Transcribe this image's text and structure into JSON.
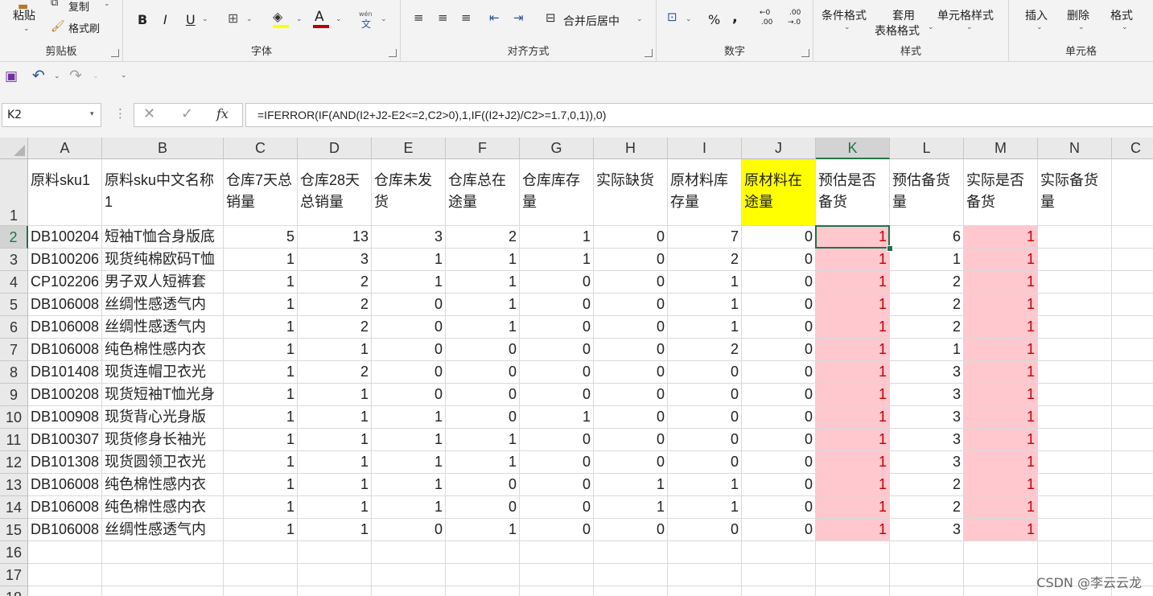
{
  "ribbon": {
    "clipboard": {
      "paste": "粘贴",
      "copy": "复制",
      "format_painter": "格式刷",
      "label": "剪贴板"
    },
    "font": {
      "label": "字体",
      "bold": "B",
      "italic": "I",
      "underline": "U",
      "font_color": "A",
      "phonetic_top": "wén",
      "phonetic_bottom": "文"
    },
    "alignment": {
      "merge_center": "合并后居中",
      "label": "对齐方式"
    },
    "number": {
      "percent": "%",
      "comma": ",",
      "inc_decimal_top": "←0",
      "inc_decimal_bottom": ".00",
      "dec_decimal_top": ".00",
      "dec_decimal_bottom": "→.0",
      "label": "数字"
    },
    "styles": {
      "conditional": "条件格式",
      "table_top": "套用",
      "table_bottom": "表格格式",
      "cell_styles": "单元格样式",
      "label": "样式"
    },
    "cells": {
      "insert": "插入",
      "delete": "删除",
      "format": "格式",
      "label": "单元格"
    }
  },
  "name_box": "K2",
  "formula": "=IFERROR(IF(AND(I2+J2-E2<=2,C2>0),1,IF((I2+J2)/C2>=1.7,0,1)),0)",
  "fx": "fx",
  "columns": [
    "A",
    "B",
    "C",
    "D",
    "E",
    "F",
    "G",
    "H",
    "I",
    "J",
    "K",
    "L",
    "M",
    "N",
    "C"
  ],
  "rows": [
    "1",
    "2",
    "3",
    "4",
    "5",
    "6",
    "7",
    "8",
    "9",
    "10",
    "11",
    "12",
    "13",
    "14",
    "15",
    "16",
    "17",
    "18"
  ],
  "headers": [
    "原料sku1",
    "原料sku中文名称1",
    "仓库7天总销量",
    "仓库28天总销量",
    "仓库未发货",
    "仓库总在途量",
    "仓库库存量",
    "实际缺货",
    "原材料库存量",
    "原材料在途量",
    "预估是否备货",
    "预估备货量",
    "实际是否备货",
    "实际备货量"
  ],
  "table": [
    [
      "DB100204",
      "短袖T恤合身版底",
      "5",
      "13",
      "3",
      "2",
      "1",
      "0",
      "7",
      "0",
      "1",
      "6",
      "1",
      ""
    ],
    [
      "DB100206",
      "现货纯棉欧码T恤",
      "1",
      "3",
      "1",
      "1",
      "1",
      "0",
      "2",
      "0",
      "1",
      "1",
      "1",
      ""
    ],
    [
      "CP102206",
      "男子双人短裤套",
      "1",
      "2",
      "1",
      "1",
      "0",
      "0",
      "1",
      "0",
      "1",
      "2",
      "1",
      ""
    ],
    [
      "DB106008",
      "丝绸性感透气内",
      "1",
      "2",
      "0",
      "1",
      "0",
      "0",
      "1",
      "0",
      "1",
      "2",
      "1",
      ""
    ],
    [
      "DB106008",
      "丝绸性感透气内",
      "1",
      "2",
      "0",
      "1",
      "0",
      "0",
      "1",
      "0",
      "1",
      "2",
      "1",
      ""
    ],
    [
      "DB106008",
      "纯色棉性感内衣",
      "1",
      "1",
      "0",
      "0",
      "0",
      "0",
      "2",
      "0",
      "1",
      "1",
      "1",
      ""
    ],
    [
      "DB101408",
      "现货连帽卫衣光",
      "1",
      "2",
      "0",
      "0",
      "0",
      "0",
      "0",
      "0",
      "1",
      "3",
      "1",
      ""
    ],
    [
      "DB100208",
      "现货短袖T恤光身",
      "1",
      "1",
      "0",
      "0",
      "0",
      "0",
      "0",
      "0",
      "1",
      "3",
      "1",
      ""
    ],
    [
      "DB100908",
      "现货背心光身版",
      "1",
      "1",
      "1",
      "0",
      "1",
      "0",
      "0",
      "0",
      "1",
      "3",
      "1",
      ""
    ],
    [
      "DB100307",
      "现货修身长袖光",
      "1",
      "1",
      "1",
      "1",
      "0",
      "0",
      "0",
      "0",
      "1",
      "3",
      "1",
      ""
    ],
    [
      "DB101308",
      "现货圆领卫衣光",
      "1",
      "1",
      "1",
      "1",
      "0",
      "0",
      "0",
      "0",
      "1",
      "3",
      "1",
      ""
    ],
    [
      "DB106008",
      "纯色棉性感内衣",
      "1",
      "1",
      "1",
      "0",
      "0",
      "1",
      "1",
      "0",
      "1",
      "2",
      "1",
      ""
    ],
    [
      "DB106008",
      "纯色棉性感内衣",
      "1",
      "1",
      "1",
      "0",
      "0",
      "1",
      "1",
      "0",
      "1",
      "2",
      "1",
      ""
    ],
    [
      "DB106008",
      "丝绸性感透气内",
      "1",
      "1",
      "0",
      "1",
      "0",
      "0",
      "0",
      "0",
      "1",
      "3",
      "1",
      ""
    ]
  ],
  "colors": {
    "accent": "#217346",
    "highlight_yellow": "#ffff00",
    "flag_pink": "#ffc7ce",
    "flag_red": "#c00000"
  },
  "watermark": "CSDN @李云云龙"
}
